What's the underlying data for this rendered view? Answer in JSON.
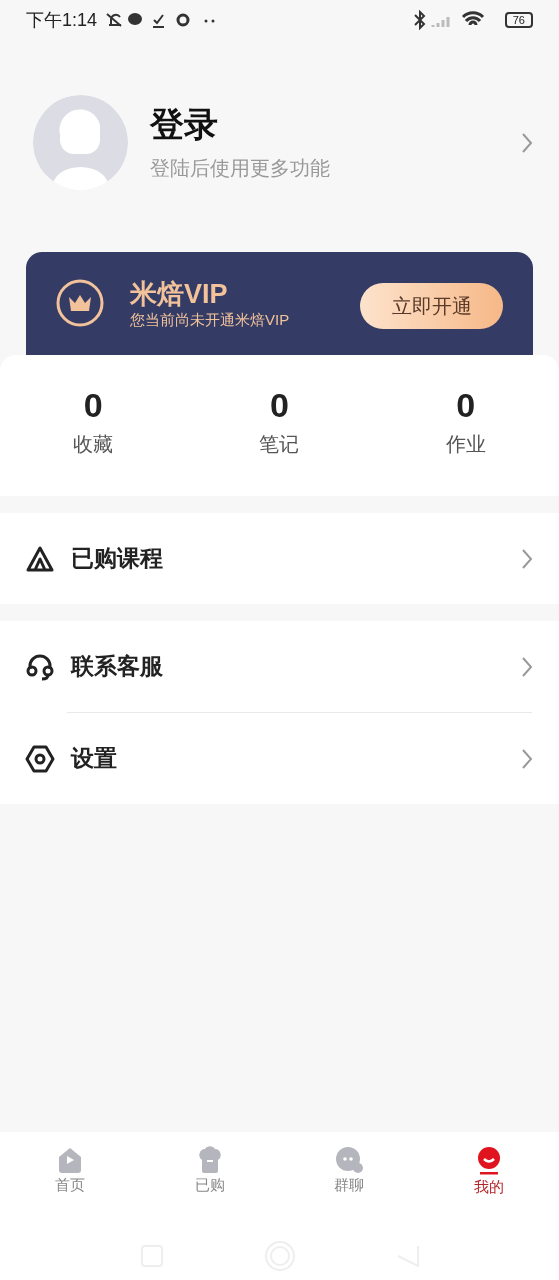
{
  "status_bar": {
    "time": "下午1:14",
    "battery": "76"
  },
  "profile": {
    "title": "登录",
    "subtitle": "登陆后使用更多功能"
  },
  "vip": {
    "title": "米焙VIP",
    "subtitle": "您当前尚未开通米焙VIP",
    "button": "立即开通"
  },
  "stats": [
    {
      "value": "0",
      "label": "收藏"
    },
    {
      "value": "0",
      "label": "笔记"
    },
    {
      "value": "0",
      "label": "作业"
    }
  ],
  "menu_groups": [
    [
      {
        "kind": "course",
        "label": "已购课程"
      }
    ],
    [
      {
        "kind": "service",
        "label": "联系客服"
      },
      {
        "kind": "settings",
        "label": "设置"
      }
    ]
  ],
  "tabs": [
    {
      "kind": "home",
      "label": "首页",
      "selected": false
    },
    {
      "kind": "bought",
      "label": "已购",
      "selected": false
    },
    {
      "kind": "chat",
      "label": "群聊",
      "selected": false
    },
    {
      "kind": "mine",
      "label": "我的",
      "selected": true
    }
  ]
}
